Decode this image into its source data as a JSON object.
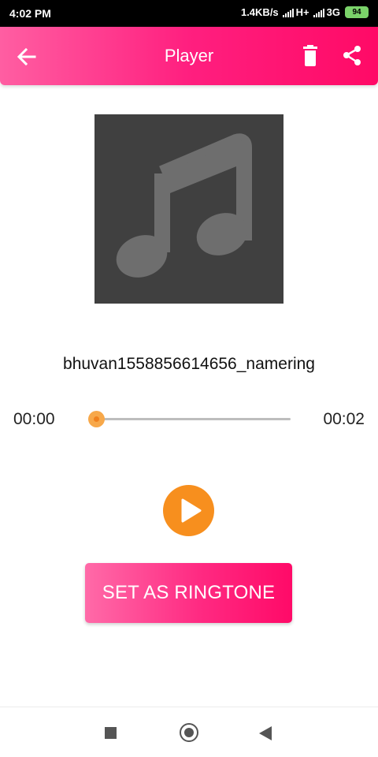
{
  "status_bar": {
    "time": "4:02 PM",
    "speed": "1.4KB/s",
    "network_1": "H+",
    "network_2": "3G",
    "battery": "94"
  },
  "app_bar": {
    "title": "Player",
    "icons": [
      "back-arrow-icon",
      "trash-icon",
      "share-icon"
    ]
  },
  "album_art": {
    "icon": "music-note-icon"
  },
  "track": {
    "name": "bhuvan1558856614656_namering"
  },
  "player": {
    "current_time": "00:00",
    "total_time": "00:02",
    "progress": 0,
    "play_icon": "play-icon"
  },
  "actions": {
    "set_ringtone_label": "SET AS RINGTONE"
  },
  "nav_bar": {
    "icons": [
      "recents-icon",
      "home-icon",
      "back-icon"
    ]
  },
  "colors": {
    "accent_pink": "#ff1f7f",
    "accent_orange": "#f78f1e",
    "album_bg": "#404040"
  }
}
